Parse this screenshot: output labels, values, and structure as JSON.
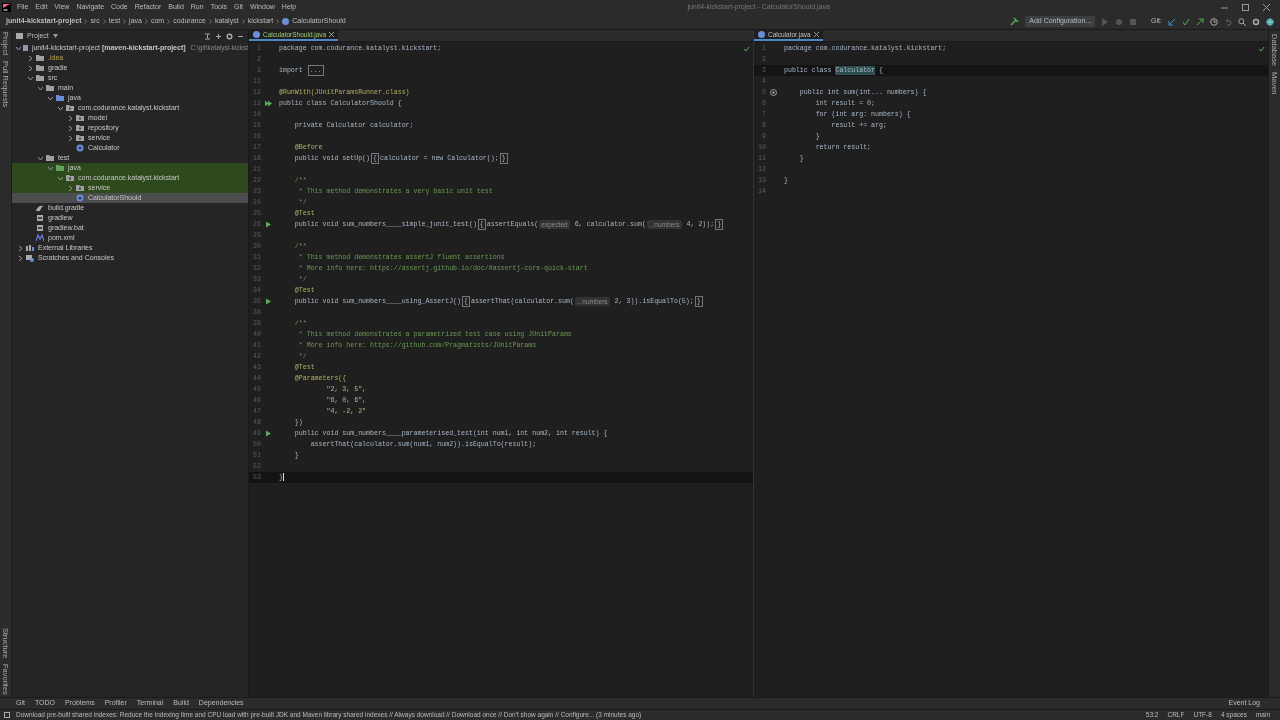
{
  "window": {
    "title": "junit4-kickstart-project - CalculatorShould.java"
  },
  "menu": [
    "File",
    "Edit",
    "View",
    "Navigate",
    "Code",
    "Refactor",
    "Build",
    "Run",
    "Tools",
    "Git",
    "Window",
    "Help"
  ],
  "breadcrumbs": [
    "junit4-kickstart-project",
    "src",
    "test",
    "java",
    "com",
    "codurance",
    "katalyst",
    "kickstart",
    "CalculatorShould"
  ],
  "toolbar": {
    "run_config": "Add Configuration...",
    "vcs_label": "Git:"
  },
  "left_stripe": {
    "top": [
      "Project",
      "Pull Requests"
    ],
    "bottom": [
      "Structure",
      "Favorites"
    ]
  },
  "right_stripe": [
    "Database",
    "Maven"
  ],
  "project": {
    "title": "Project",
    "tree": [
      {
        "label": "junit4-kickstart-project **[maven-kickstart-project]**",
        "path": "C:\\git\\katalyst-kickst",
        "kind": "module",
        "expanded": true,
        "selected": false,
        "children": [
          {
            "label": ".idea",
            "kind": "folder",
            "expanded": false,
            "selected": false,
            "excluded": true
          },
          {
            "label": "gradle",
            "kind": "folder",
            "expanded": false,
            "selected": false
          },
          {
            "label": "src",
            "kind": "folder",
            "expanded": true,
            "selected": false,
            "children": [
              {
                "label": "main",
                "kind": "folder",
                "expanded": true,
                "selected": false,
                "children": [
                  {
                    "label": "java",
                    "kind": "source",
                    "expanded": true,
                    "selected": false,
                    "children": [
                      {
                        "label": "com.codurance.katalyst.kickstart",
                        "kind": "package",
                        "expanded": true,
                        "selected": false,
                        "children": [
                          {
                            "label": "model",
                            "kind": "package",
                            "expanded": false,
                            "selected": false
                          },
                          {
                            "label": "repository",
                            "kind": "package",
                            "expanded": false,
                            "selected": false
                          },
                          {
                            "label": "service",
                            "kind": "package",
                            "expanded": false,
                            "selected": false
                          },
                          {
                            "label": "Calculator",
                            "kind": "class",
                            "selected": false
                          }
                        ]
                      }
                    ]
                  }
                ]
              },
              {
                "label": "test",
                "kind": "folder",
                "expanded": true,
                "selected": false,
                "children": [
                  {
                    "label": "java",
                    "kind": "test_source",
                    "expanded": true,
                    "selected": false,
                    "children": [
                      {
                        "label": "com.codurance.katalyst.kickstart",
                        "kind": "package",
                        "expanded": true,
                        "selected": false,
                        "children": [
                          {
                            "label": "service",
                            "kind": "package",
                            "expanded": false,
                            "selected": false
                          },
                          {
                            "label": "CalculatorShould",
                            "kind": "class",
                            "selected": true
                          }
                        ]
                      }
                    ]
                  }
                ]
              }
            ]
          },
          {
            "label": "build.gradle",
            "kind": "gradle",
            "selected": false
          },
          {
            "label": "gradlew",
            "kind": "file",
            "selected": false
          },
          {
            "label": "gradlew.bat",
            "kind": "file",
            "selected": false
          },
          {
            "label": "pom.xml",
            "kind": "maven",
            "selected": false
          }
        ]
      },
      {
        "label": "External Libraries",
        "kind": "library",
        "expanded": false,
        "selected": false
      },
      {
        "label": "Scratches and Consoles",
        "kind": "scratch",
        "expanded": false,
        "selected": false
      }
    ]
  },
  "editors": [
    {
      "tab": {
        "label": "CalculatorShould.java",
        "selected": true
      },
      "lines": [
        {
          "n": "1",
          "parts": [
            {
              "kind": "code",
              "text": "package com.codurance.katalyst.kickstart;"
            }
          ]
        },
        {
          "n": "2"
        },
        {
          "n": "3",
          "parts": [
            {
              "kind": "code",
              "text": "import "
            },
            {
              "kind": "fold",
              "text": "..."
            }
          ]
        },
        {
          "n": "11"
        },
        {
          "n": "12",
          "parts": [
            {
              "kind": "annotation",
              "text": "@RunWith(JUnitParamsRunner.class)"
            }
          ]
        },
        {
          "n": "13",
          "kind": "run_class",
          "parts": [
            {
              "kind": "code",
              "text": "public class CalculatorShould {"
            }
          ]
        },
        {
          "n": "14"
        },
        {
          "n": "15",
          "parts": [
            {
              "kind": "code",
              "text": "    private Calculator calculator;"
            }
          ]
        },
        {
          "n": "16"
        },
        {
          "n": "17",
          "parts": [
            {
              "kind": "annotation",
              "text": "    @Before"
            }
          ]
        },
        {
          "n": "18",
          "parts": [
            {
              "kind": "code",
              "text": "    public void setUp()"
            },
            {
              "kind": "fold",
              "text": "{"
            },
            {
              "kind": "code",
              "text": "calculator = new Calculator();"
            },
            {
              "kind": "fold",
              "text": "}"
            }
          ]
        },
        {
          "n": "21"
        },
        {
          "n": "22",
          "parts": [
            {
              "kind": "comment",
              "text": "    /**"
            }
          ]
        },
        {
          "n": "23",
          "parts": [
            {
              "kind": "comment",
              "text": "     * This method demonstrates a very basic unit test"
            }
          ]
        },
        {
          "n": "24",
          "parts": [
            {
              "kind": "comment",
              "text": "     */"
            }
          ]
        },
        {
          "n": "25",
          "parts": [
            {
              "kind": "annotation",
              "text": "    @Test"
            }
          ]
        },
        {
          "n": "26",
          "kind": "run",
          "parts": [
            {
              "kind": "code",
              "text": "    public void sum_numbers____simple_junit_test()"
            },
            {
              "kind": "fold",
              "text": "{"
            },
            {
              "kind": "code",
              "text": "assertEquals("
            },
            {
              "kind": "hint",
              "text": "expected"
            },
            {
              "kind": "code",
              "text": " 6, calculator.sum("
            },
            {
              "kind": "hint",
              "text": "...numbers"
            },
            {
              "kind": "code",
              "text": " 4, 2));"
            },
            {
              "kind": "fold",
              "text": "}"
            }
          ]
        },
        {
          "n": "29"
        },
        {
          "n": "30",
          "parts": [
            {
              "kind": "comment",
              "text": "    /**"
            }
          ]
        },
        {
          "n": "31",
          "parts": [
            {
              "kind": "comment",
              "text": "     * This method demonstrates assertJ fluent assertions"
            }
          ]
        },
        {
          "n": "32",
          "parts": [
            {
              "kind": "comment",
              "text": "     * More info here: https://assertj.github.io/doc/#assertj-core-quick-start"
            }
          ]
        },
        {
          "n": "33",
          "parts": [
            {
              "kind": "comment",
              "text": "     */"
            }
          ]
        },
        {
          "n": "34",
          "parts": [
            {
              "kind": "annotation",
              "text": "    @Test"
            }
          ]
        },
        {
          "n": "35",
          "kind": "run",
          "parts": [
            {
              "kind": "code",
              "text": "    public void sum_numbers____using_AssertJ()"
            },
            {
              "kind": "fold",
              "text": "{"
            },
            {
              "kind": "code",
              "text": "assertThat(calculator.sum("
            },
            {
              "kind": "hint",
              "text": "...numbers"
            },
            {
              "kind": "code",
              "text": " 2, 3)).isEqualTo(5);"
            },
            {
              "kind": "fold",
              "text": "}"
            }
          ]
        },
        {
          "n": "38"
        },
        {
          "n": "39",
          "parts": [
            {
              "kind": "comment",
              "text": "    /**"
            }
          ]
        },
        {
          "n": "40",
          "parts": [
            {
              "kind": "comment",
              "text": "     * This method demonstrates a parametrized test case using JUnitParams"
            }
          ]
        },
        {
          "n": "41",
          "parts": [
            {
              "kind": "comment",
              "text": "     * More info here: https://github.com/Pragmatists/JUnitParams"
            }
          ]
        },
        {
          "n": "42",
          "parts": [
            {
              "kind": "comment",
              "text": "     */"
            }
          ]
        },
        {
          "n": "43",
          "parts": [
            {
              "kind": "annotation",
              "text": "    @Test"
            }
          ]
        },
        {
          "n": "44",
          "parts": [
            {
              "kind": "annotation",
              "text": "    @Parameters({"
            }
          ]
        },
        {
          "n": "45",
          "parts": [
            {
              "kind": "string",
              "text": "            \"2, 3, 5\","
            }
          ]
        },
        {
          "n": "46",
          "parts": [
            {
              "kind": "string",
              "text": "            \"6, 0, 6\","
            }
          ]
        },
        {
          "n": "47",
          "parts": [
            {
              "kind": "string",
              "text": "            \"4, -2, 2\""
            }
          ]
        },
        {
          "n": "48",
          "parts": [
            {
              "kind": "code",
              "text": "    })"
            }
          ]
        },
        {
          "n": "49",
          "kind": "run",
          "parts": [
            {
              "kind": "code",
              "text": "    public void sum_numbers____parameterised_test(int num1, int num2, int result) {"
            }
          ]
        },
        {
          "n": "50",
          "parts": [
            {
              "kind": "code",
              "text": "        assertThat(calculator.sum(num1, num2)).isEqualTo(result);"
            }
          ]
        },
        {
          "n": "51",
          "parts": [
            {
              "kind": "code",
              "text": "    }"
            }
          ]
        },
        {
          "n": "52"
        },
        {
          "n": "53",
          "current": true,
          "parts": [
            {
              "kind": "code",
              "text": "}"
            }
          ]
        }
      ]
    },
    {
      "tab": {
        "label": "Calculator.java",
        "selected": true
      },
      "lines": [
        {
          "n": "1",
          "parts": [
            {
              "kind": "code",
              "text": "package com.codurance.katalyst.kickstart;"
            }
          ]
        },
        {
          "n": "2"
        },
        {
          "n": "3",
          "current": true,
          "parts": [
            {
              "kind": "code",
              "text": "public class "
            },
            {
              "kind": "match",
              "text": "Calculator"
            },
            {
              "kind": "code",
              "text": " {"
            }
          ]
        },
        {
          "n": "4"
        },
        {
          "n": "5",
          "kind": "override",
          "parts": [
            {
              "kind": "code",
              "text": "    public int sum(int... numbers) {"
            }
          ]
        },
        {
          "n": "6",
          "parts": [
            {
              "kind": "code",
              "text": "        int result = 0;"
            }
          ]
        },
        {
          "n": "7",
          "parts": [
            {
              "kind": "code",
              "text": "        for (int arg: numbers) {"
            }
          ]
        },
        {
          "n": "8",
          "parts": [
            {
              "kind": "code",
              "text": "            result += arg;"
            }
          ]
        },
        {
          "n": "9",
          "parts": [
            {
              "kind": "code",
              "text": "        }"
            }
          ]
        },
        {
          "n": "10",
          "parts": [
            {
              "kind": "code",
              "text": "        return result;"
            }
          ]
        },
        {
          "n": "11",
          "parts": [
            {
              "kind": "code",
              "text": "    }"
            }
          ]
        },
        {
          "n": "12"
        },
        {
          "n": "13",
          "parts": [
            {
              "kind": "code",
              "text": "}"
            }
          ]
        },
        {
          "n": "14"
        }
      ]
    }
  ],
  "tool_tabs": [
    "Git",
    "TODO",
    "Problems",
    "Profiler",
    "Terminal",
    "Build",
    "Dependencies"
  ],
  "event_log": "Event Log",
  "status_bar": {
    "message": "Download pre-built shared indexes: Reduce the indexing time and CPU load with pre-built JDK and Maven library shared indexes // Always download // Download once // Don't show again // Configure... (3 minutes ago)",
    "items": [
      "53:2",
      "CRLF",
      "UTF-8",
      "4 spaces",
      "main"
    ]
  }
}
